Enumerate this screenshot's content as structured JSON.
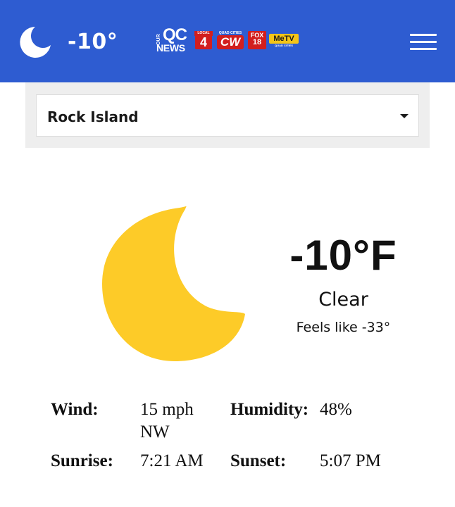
{
  "header": {
    "temp": "-10°",
    "moon_icon": "crescent-moon-icon",
    "logos": {
      "our": "OUR",
      "qc": "QC",
      "news": "NEWS",
      "local4_tag": "LOCAL",
      "local4_num": "4",
      "cw_top": "QUAD CITIES",
      "cw_mark": "CW",
      "fox_top": "FOX",
      "fox_num": "18",
      "metv": "MeTV",
      "metv_sub": "QUAD CITIES"
    },
    "menu_icon": "hamburger-menu-icon"
  },
  "location": {
    "selected": "Rock Island"
  },
  "current": {
    "temp": "-10°F",
    "condition": "Clear",
    "feels_like": "Feels like -33°",
    "icon": "crescent-moon-icon"
  },
  "details": {
    "wind_label": "Wind:",
    "wind_value_1": "15 mph",
    "wind_value_2": "NW",
    "humidity_label": "Humidity:",
    "humidity_value": "48%",
    "sunrise_label": "Sunrise:",
    "sunrise_value": "7:21 AM",
    "sunset_label": "Sunset:",
    "sunset_value": "5:07 PM"
  },
  "colors": {
    "header_bg": "#2e5cd1",
    "moon_yellow": "#fdcb28",
    "brand_red": "#d21e1e",
    "metv_yellow": "#f5c518"
  }
}
